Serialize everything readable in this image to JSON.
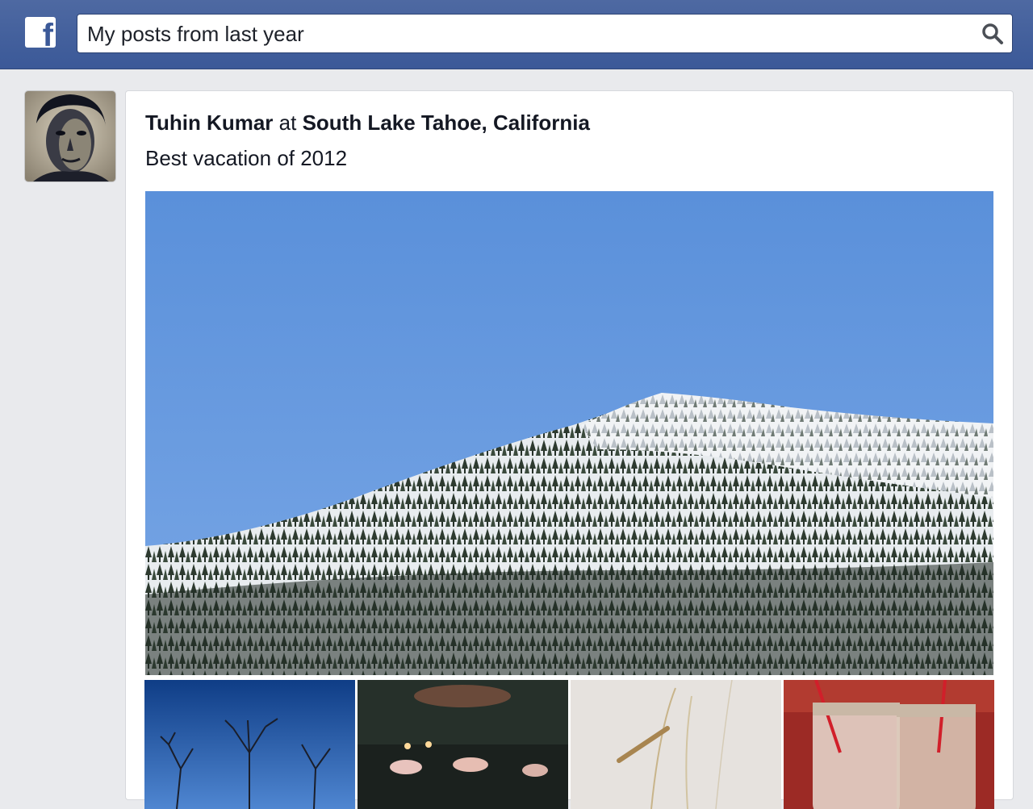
{
  "search": {
    "value": "My posts from last year",
    "icon": "search-icon"
  },
  "post": {
    "author": "Tuhin Kumar",
    "at_word": "at",
    "location": "South Lake Tahoe, California",
    "status": "Best vacation of 2012"
  },
  "colors": {
    "brand": "#3b5998",
    "background": "#e9eaed"
  }
}
